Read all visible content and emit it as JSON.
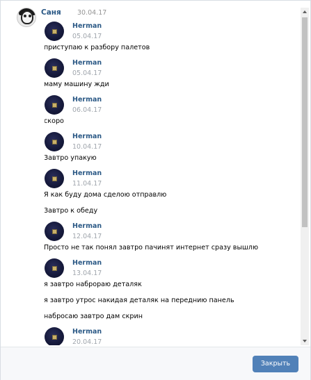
{
  "header": {
    "name": "Саня",
    "date": "30.04.17"
  },
  "messages": [
    {
      "author": "Herman",
      "date": "05.04.17",
      "lines": [
        "приступаю к разбору палетов"
      ]
    },
    {
      "author": "Herman",
      "date": "05.04.17",
      "lines": [
        "маму машину жди"
      ]
    },
    {
      "author": "Herman",
      "date": "06.04.17",
      "lines": [
        "скоро"
      ]
    },
    {
      "author": "Herman",
      "date": "10.04.17",
      "lines": [
        "Завтро упакую"
      ]
    },
    {
      "author": "Herman",
      "date": "11.04.17",
      "lines": [
        "Я как буду дома сделою отправлю",
        "Завтро к обеду"
      ]
    },
    {
      "author": "Herman",
      "date": "12.04.17",
      "lines": [
        "Просто не так понял завтро пачинят интернет сразу вышлю"
      ]
    },
    {
      "author": "Herman",
      "date": "13.04.17",
      "lines": [
        "я завтро наброраю деталяк",
        "я завтро утрос накидая деталяк на переднию панель",
        "набросаю завтро дам скрин"
      ]
    },
    {
      "author": "Herman",
      "date": "20.04.17",
      "lines": []
    }
  ],
  "footer": {
    "close_label": "Закрыть"
  },
  "colors": {
    "link": "#2a5885",
    "button": "#5181b8",
    "date": "#939393"
  }
}
